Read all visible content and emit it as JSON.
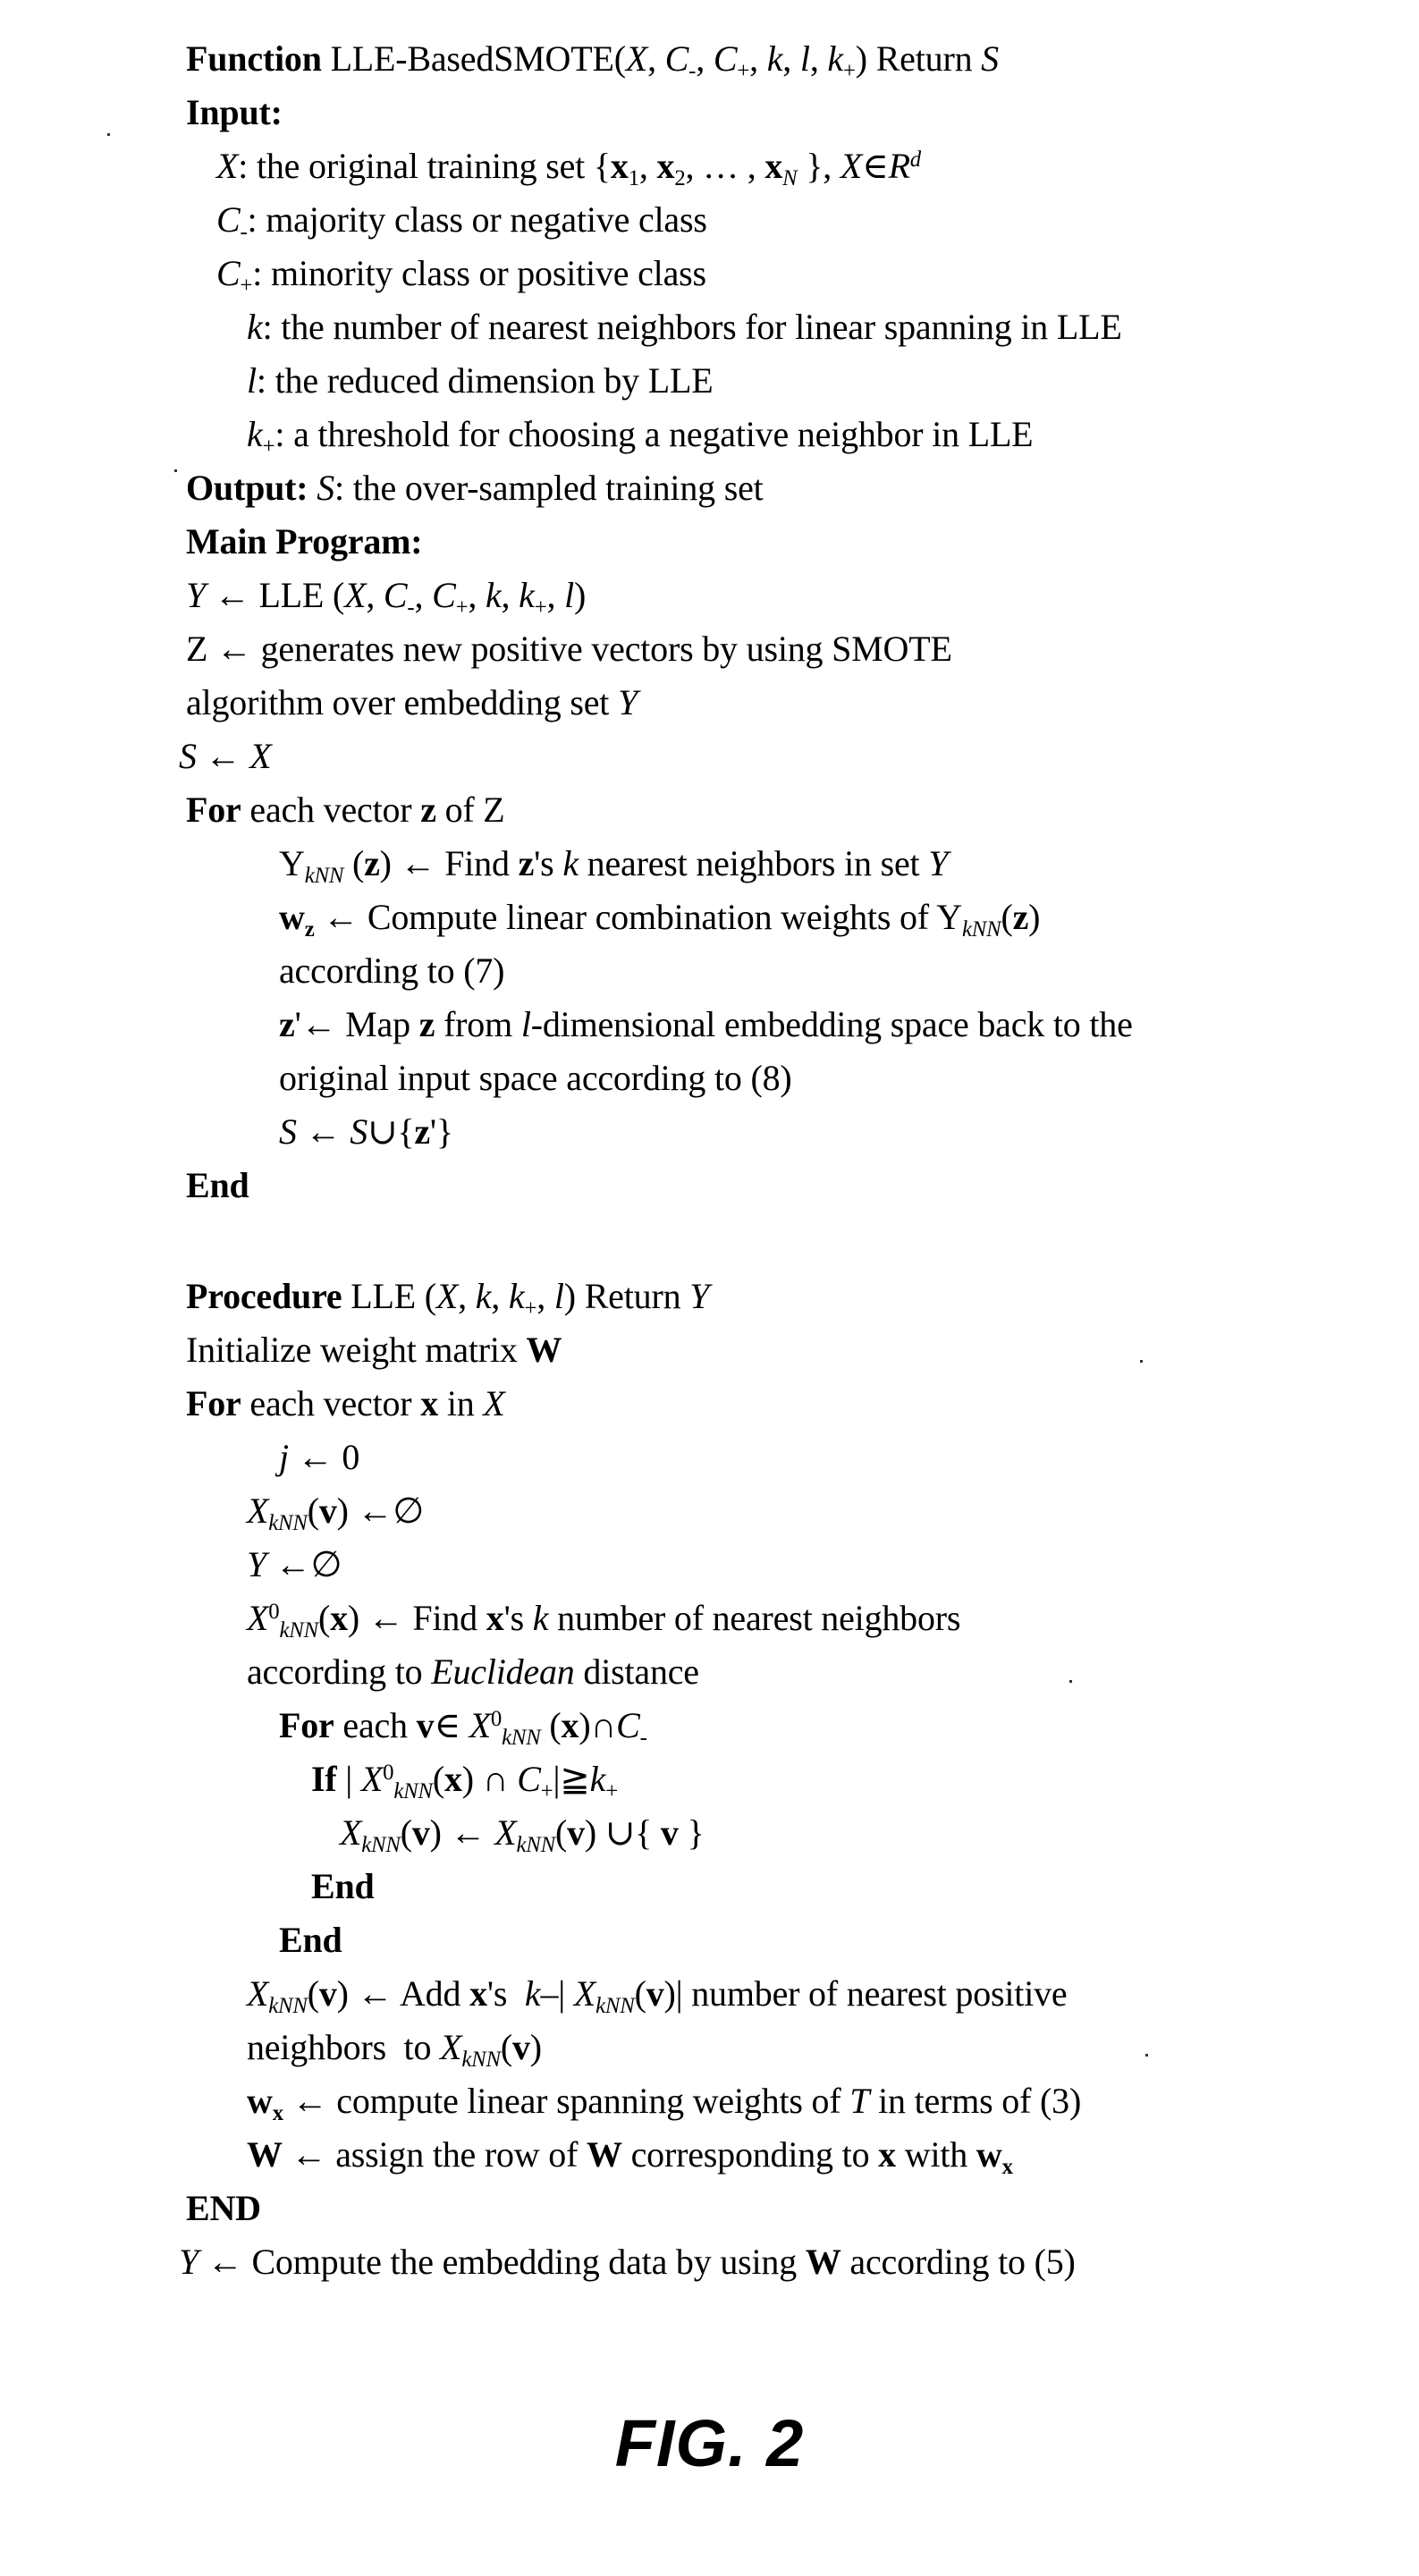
{
  "figure": {
    "label": "FIG. 2",
    "caption_number": "2"
  },
  "algorithm": {
    "title": "Function LLE-BasedSMOTE(X, C-, C+, k, l, k+) Return S",
    "sections": [
      {
        "name": "input_header",
        "text": "Input:"
      },
      {
        "name": "output_header",
        "text": "Output: S: the over-sampled training set"
      },
      {
        "name": "main_program_header",
        "text": "Main Program:"
      },
      {
        "name": "procedure_header",
        "text": "Procedure LLE (X, k, k+, l) Return Y"
      }
    ],
    "lines": [
      {
        "id": "l01",
        "text": "Function LLE-BasedSMOTE(X, C-, C+, k, l, k+) Return S",
        "indent": 0
      },
      {
        "id": "l02",
        "text": "Input:",
        "indent": 0
      },
      {
        "id": "l03",
        "text": "X: the original training set {x1, x2, ... , xN }, X∈Rd",
        "indent": 1
      },
      {
        "id": "l04",
        "text": "C-: majority class or negative class",
        "indent": 1
      },
      {
        "id": "l05",
        "text": "C+: minority class or positive class",
        "indent": 1
      },
      {
        "id": "l06",
        "text": "k: the number of nearest neighbors for linear spanning in LLE",
        "indent": 1
      },
      {
        "id": "l07",
        "text": "l: the reduced dimension by LLE",
        "indent": 1
      },
      {
        "id": "l08",
        "text": "k+: a threshold for choosing a negative neighbor in LLE",
        "indent": 1
      },
      {
        "id": "l09",
        "text": "Output: S: the over-sampled training set",
        "indent": 0
      },
      {
        "id": "l10",
        "text": "Main Program:",
        "indent": 0
      },
      {
        "id": "l11",
        "text": "Y ← LLE (X, C-, C+, k, k+, l)",
        "indent": 0
      },
      {
        "id": "l12",
        "text": "Z ← generates new positive vectors by using SMOTE",
        "indent": 0
      },
      {
        "id": "l13",
        "text": "algorithm over embedding set Y",
        "indent": 0
      },
      {
        "id": "l14",
        "text": "S ← X",
        "indent": 0
      },
      {
        "id": "l15",
        "text": "For each vector z of Z",
        "indent": 0
      },
      {
        "id": "l16",
        "text": "YkNN (z) ← Find z's k nearest neighbors in set Y",
        "indent": 2
      },
      {
        "id": "l17",
        "text": "wz ← Compute linear combination weights of YkNN(z)",
        "indent": 2
      },
      {
        "id": "l18",
        "text": "according to (7)",
        "indent": 2
      },
      {
        "id": "l19",
        "text": "z' ← Map z from l-dimensional embedding space back to the",
        "indent": 2
      },
      {
        "id": "l20",
        "text": "original input space according to (8)",
        "indent": 2
      },
      {
        "id": "l21",
        "text": "S ← S∪{z'}",
        "indent": 2
      },
      {
        "id": "l22",
        "text": "End",
        "indent": 0
      },
      {
        "id": "l23",
        "text": "Procedure LLE (X, k, k+, l) Return Y",
        "indent": 0
      },
      {
        "id": "l24",
        "text": "Initialize weight matrix W",
        "indent": 0
      },
      {
        "id": "l25",
        "text": "For each vector x in X",
        "indent": 0
      },
      {
        "id": "l26",
        "text": "j ← 0",
        "indent": 2
      },
      {
        "id": "l27",
        "text": "XkNN(v) ← ∅",
        "indent": 1
      },
      {
        "id": "l28",
        "text": "Y ← ∅",
        "indent": 1
      },
      {
        "id": "l29",
        "text": "X0kNN(x) ← Find x's k number of nearest neighbors",
        "indent": 1
      },
      {
        "id": "l30",
        "text": "according to Euclidean distance",
        "indent": 1
      },
      {
        "id": "l31",
        "text": "For each v∈ X0kNN (x)∩C-",
        "indent": 2
      },
      {
        "id": "l32",
        "text": "If | X0kNN(x) ∩ C+|≧k+",
        "indent": 3
      },
      {
        "id": "l33",
        "text": "XkNN(v) ← XkNN(v) ∪{ v }",
        "indent": 4
      },
      {
        "id": "l34",
        "text": "End",
        "indent": 3
      },
      {
        "id": "l35",
        "text": "End",
        "indent": 2
      },
      {
        "id": "l36",
        "text": "XkNN(v) ← Add x's  k-| XkNN(v)| number of nearest positive",
        "indent": 1
      },
      {
        "id": "l37",
        "text": "neighbors  to XkNN(v)",
        "indent": 1
      },
      {
        "id": "l38",
        "text": "wx ← compute linear spanning weights of T in terms of (3)",
        "indent": 1
      },
      {
        "id": "l39",
        "text": "W ← assign the row of W corresponding to x with wx",
        "indent": 1
      },
      {
        "id": "l40",
        "text": "END",
        "indent": 0
      },
      {
        "id": "l41",
        "text": "Y ← Compute the embedding data by using W according to (5)",
        "indent": 0
      }
    ],
    "symbols": {
      "arrow": "←",
      "union": "∪",
      "intersection": "∩",
      "element_of": "∈",
      "empty_set": "∅",
      "greater_equal": "≧",
      "reals": "R"
    }
  }
}
